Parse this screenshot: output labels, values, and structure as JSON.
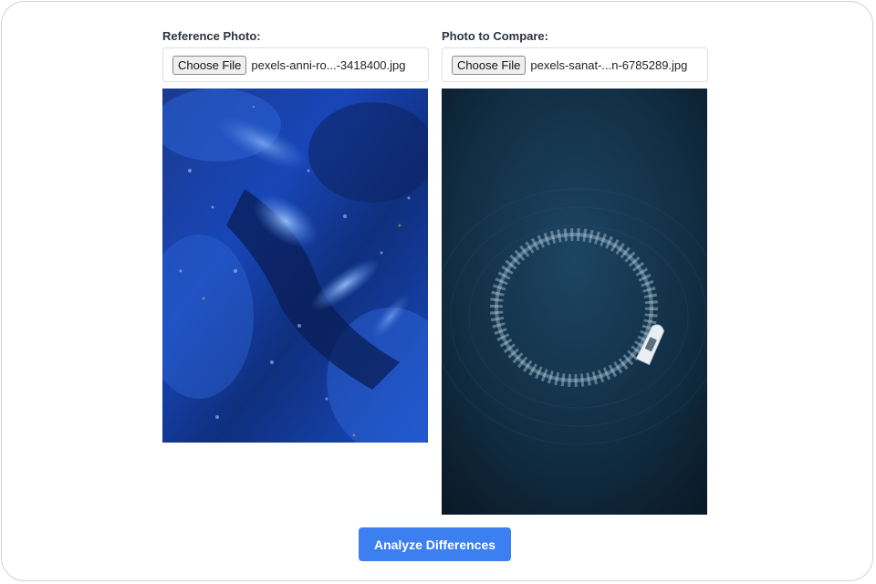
{
  "reference": {
    "label": "Reference Photo:",
    "button_label": "Choose File",
    "file_name": "pexels-anni-ro...-3418400.jpg"
  },
  "compare": {
    "label": "Photo to Compare:",
    "button_label": "Choose File",
    "file_name": "pexels-sanat-...n-6785289.jpg"
  },
  "analyze_button": {
    "label": "Analyze Differences"
  },
  "colors": {
    "accent": "#3b7ff0",
    "label_text": "#2d3440",
    "border": "#dcdfe4"
  }
}
